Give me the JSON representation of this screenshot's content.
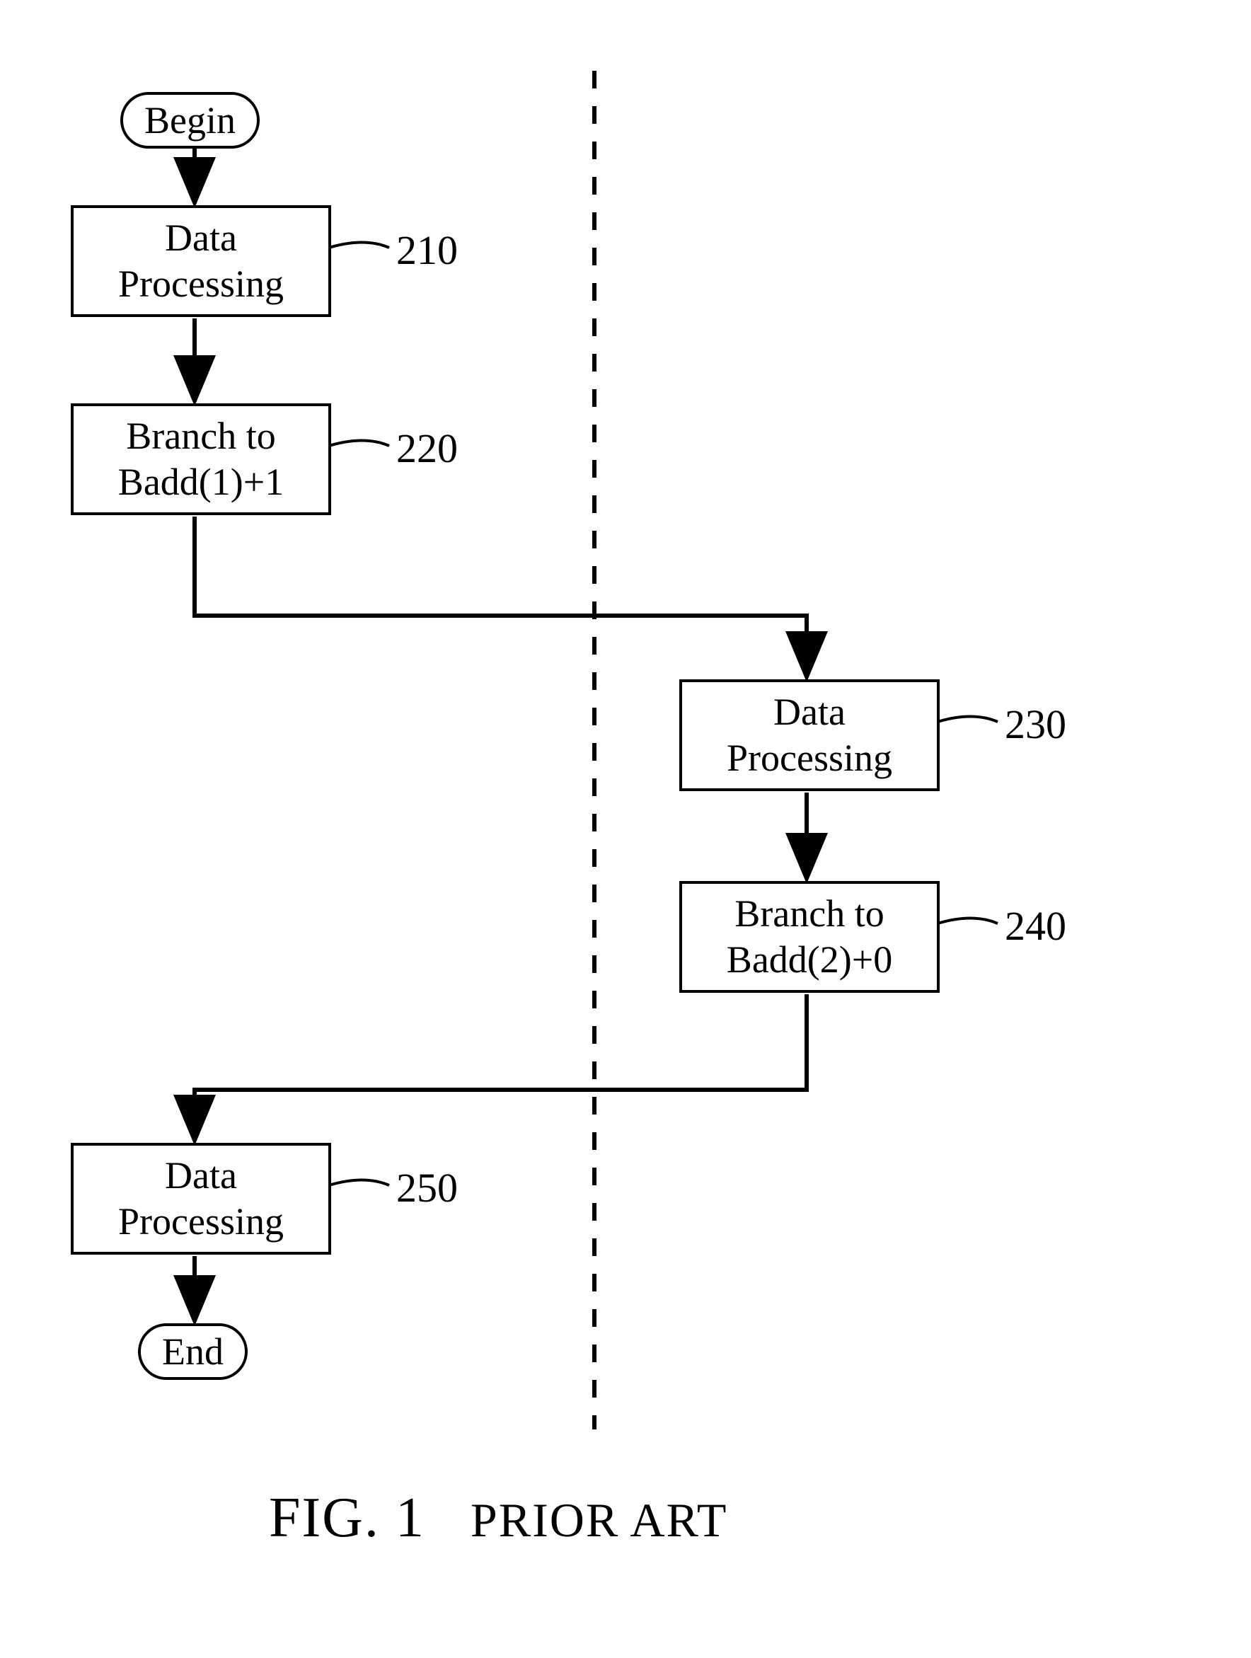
{
  "flowchart": {
    "begin": "Begin",
    "end": "End",
    "box210": {
      "line1": "Data",
      "line2": "Processing",
      "label": "210"
    },
    "box220": {
      "line1": "Branch to",
      "line2": "Badd(1)+1",
      "label": "220"
    },
    "box230": {
      "line1": "Data",
      "line2": "Processing",
      "label": "230"
    },
    "box240": {
      "line1": "Branch to",
      "line2": "Badd(2)+0",
      "label": "240"
    },
    "box250": {
      "line1": "Data",
      "line2": "Processing",
      "label": "250"
    },
    "caption": {
      "fig": "FIG. 1",
      "prior": "PRIOR ART"
    }
  }
}
